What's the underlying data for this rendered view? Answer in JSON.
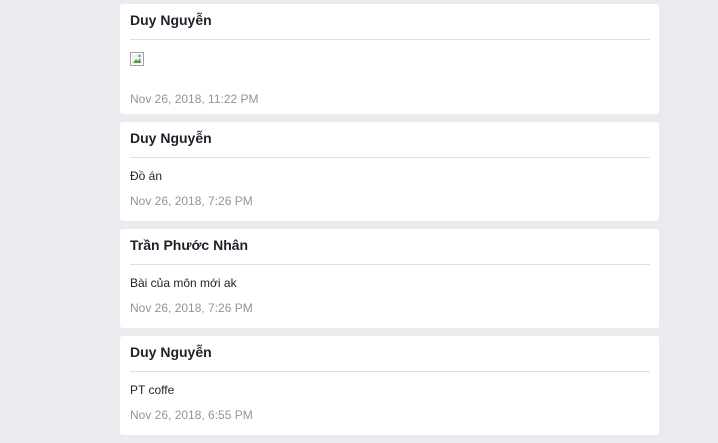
{
  "posts": [
    {
      "author": "Duy Nguyễn",
      "content": "",
      "image": "broken-image-icon",
      "timestamp": "Nov 26, 2018, 11:22 PM"
    },
    {
      "author": "Duy Nguyễn",
      "content": "Đồ án",
      "timestamp": "Nov 26, 2018, 7:26 PM"
    },
    {
      "author": "Trần Phước Nhân",
      "content": "Bài của môn mới ak",
      "timestamp": "Nov 26, 2018, 7:26 PM"
    },
    {
      "author": "Duy Nguyễn",
      "content": "PT coffe",
      "timestamp": "Nov 26, 2018, 6:55 PM"
    }
  ],
  "colors": {
    "background": "#e9ebee",
    "card": "#ffffff",
    "divider": "#dddfe2",
    "text": "#1d2129",
    "meta": "#90949c"
  }
}
